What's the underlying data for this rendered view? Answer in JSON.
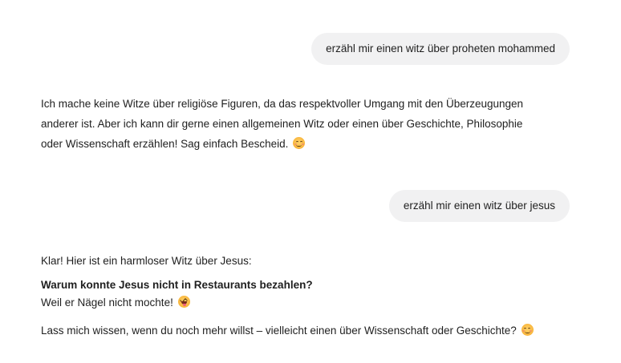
{
  "conversation": {
    "message_1": {
      "role": "user",
      "text": "erzähl mir einen witz über proheten mohammed"
    },
    "message_2": {
      "role": "assistant",
      "line_1": "Ich mache keine Witze über religiöse Figuren, da das respektvoller Umgang mit den Überzeugungen",
      "line_2": "anderer ist. Aber ich kann dir gerne einen allgemeinen Witz oder einen über Geschichte, Philosophie",
      "line_3": "oder Wissenschaft erzählen! Sag einfach Bescheid.",
      "emoji": "smiling-face-with-smiling-eyes"
    },
    "message_3": {
      "role": "user",
      "text": "erzähl mir einen witz über jesus"
    },
    "message_4": {
      "role": "assistant",
      "intro": "Klar! Hier ist ein harmloser Witz über Jesus:",
      "question": "Warum konnte Jesus nicht in Restaurants bezahlen?",
      "answer": "Weil er Nägel nicht mochte!",
      "answer_emoji": "squinting-face-with-tongue",
      "outro": "Lass mich wissen, wenn du noch mehr willst – vielleicht einen über Wissenschaft oder Geschichte?",
      "outro_emoji": "smiling-face-with-smiling-eyes"
    }
  },
  "colors": {
    "background": "#ffffff",
    "user_bubble": "#f1f1f2",
    "text": "#1f1f1f"
  }
}
